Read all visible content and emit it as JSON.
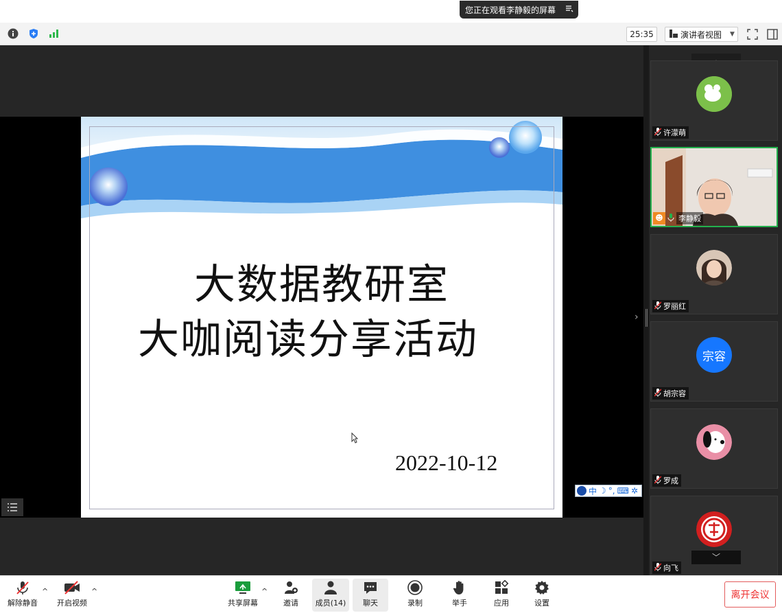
{
  "top": {
    "viewing_text": "您正在观看李静毅的屏幕"
  },
  "infobar": {
    "timer": "25:35",
    "view_mode": "演讲者视图"
  },
  "slide": {
    "title_line1": "大数据教研室",
    "title_line2": "大咖阅读分享活动",
    "date": "2022-10-12"
  },
  "ime": {
    "lang": "中"
  },
  "participants": [
    {
      "name": "许濛萌",
      "muted": true
    },
    {
      "name": "李静毅",
      "muted": false,
      "speaking": true
    },
    {
      "name": "罗丽红",
      "muted": true
    },
    {
      "name": "胡宗容",
      "muted": true,
      "avatar_text": "宗容",
      "avatar_color": "#1677ff"
    },
    {
      "name": "罗成",
      "muted": true
    },
    {
      "name": "向飞",
      "muted": true
    }
  ],
  "toolbar": {
    "unmute": "解除静音",
    "start_video": "开启视频",
    "share_screen": "共享屏幕",
    "invite": "邀请",
    "members": "成员(14)",
    "chat": "聊天",
    "record": "录制",
    "raise_hand": "举手",
    "apps": "应用",
    "settings": "设置",
    "leave": "离开会议"
  },
  "colors": {
    "accent_green": "#23b14d",
    "leave_red": "#e33333",
    "slide_blue": "#3f8fe0"
  }
}
